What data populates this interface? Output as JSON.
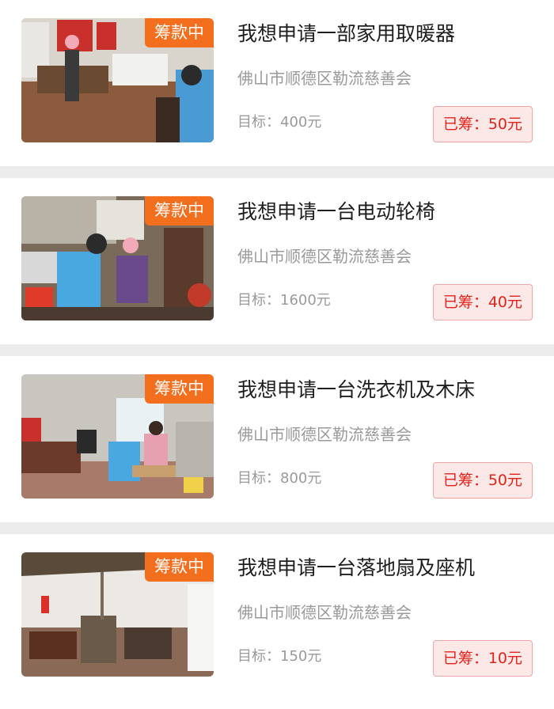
{
  "projects": [
    {
      "status_badge": "筹款中",
      "title": "我想申请一部家用取暖器",
      "organization": "佛山市顺德区勒流慈善会",
      "goal_text": "目标：400元",
      "raised_text": "已筹：50元"
    },
    {
      "status_badge": "筹款中",
      "title": "我想申请一台电动轮椅",
      "organization": "佛山市顺德区勒流慈善会",
      "goal_text": "目标：1600元",
      "raised_text": "已筹：40元"
    },
    {
      "status_badge": "筹款中",
      "title": "我想申请一台洗衣机及木床",
      "organization": "佛山市顺德区勒流慈善会",
      "goal_text": "目标：800元",
      "raised_text": "已筹：50元"
    },
    {
      "status_badge": "筹款中",
      "title": "我想申请一台落地扇及座机",
      "organization": "佛山市顺德区勒流慈善会",
      "goal_text": "目标：150元",
      "raised_text": "已筹：10元"
    }
  ],
  "colors": {
    "badge_bg": "#f36f1e",
    "raised_text": "#e2231a",
    "raised_bg": "#fde8e8"
  }
}
